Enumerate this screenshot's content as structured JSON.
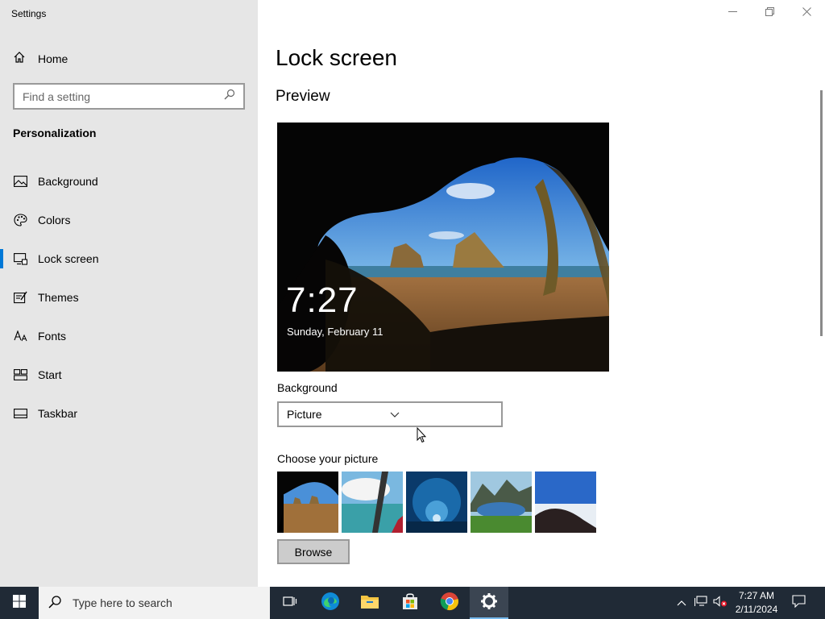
{
  "window": {
    "title": "Settings",
    "minimize_icon": "minimize-icon",
    "maximize_icon": "restore-icon",
    "close_icon": "close-icon"
  },
  "sidebar": {
    "home_label": "Home",
    "search_placeholder": "Find a setting",
    "section_title": "Personalization",
    "items": [
      {
        "label": "Background",
        "icon": "image-icon"
      },
      {
        "label": "Colors",
        "icon": "palette-icon"
      },
      {
        "label": "Lock screen",
        "icon": "lock-screen-icon",
        "active": true
      },
      {
        "label": "Themes",
        "icon": "brush-icon"
      },
      {
        "label": "Fonts",
        "icon": "font-icon"
      },
      {
        "label": "Start",
        "icon": "start-icon"
      },
      {
        "label": "Taskbar",
        "icon": "taskbar-icon"
      }
    ]
  },
  "main": {
    "title": "Lock screen",
    "preview_title": "Preview",
    "preview_time": "7:27",
    "preview_date": "Sunday, February 11",
    "background_label": "Background",
    "background_value": "Picture",
    "choose_label": "Choose your picture",
    "browse_label": "Browse"
  },
  "taskbar": {
    "search_placeholder": "Type here to search",
    "time": "7:27 AM",
    "date": "2/11/2024"
  },
  "colors": {
    "accent": "#0078d7",
    "sidebar_bg": "#e6e6e6",
    "taskbar_bg": "#202a36"
  }
}
